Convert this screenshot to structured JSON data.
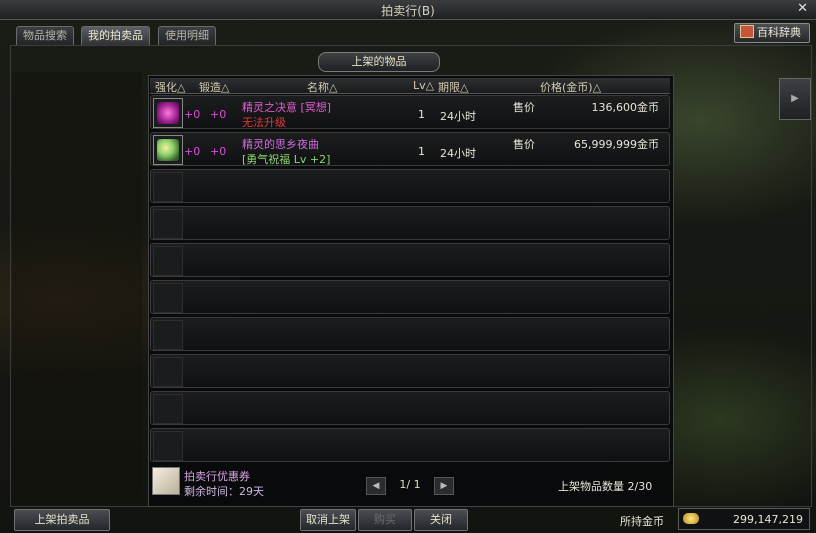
{
  "window": {
    "title": "拍卖行(B)"
  },
  "tabs": [
    {
      "label": "物品搜索",
      "active": false
    },
    {
      "label": "我的拍卖品",
      "active": true
    },
    {
      "label": "使用明细",
      "active": false
    }
  ],
  "wiki_button": {
    "label": "百科辞典",
    "icon": "book-icon"
  },
  "section": {
    "label": "上架的物品"
  },
  "headers": {
    "enhance": "强化△",
    "forge": "锻造△",
    "name": "名称△",
    "level": "Lv△",
    "period": "期限△",
    "price": "价格(金币)△"
  },
  "items": [
    {
      "enhance": "+0",
      "forge": "+0",
      "name": "精灵之决意 [冥想]",
      "sub": "无法升级",
      "level": "1",
      "period": "24小时",
      "price_label": "售价",
      "price": "136,600金币",
      "icon": "spirit-resolve-icon"
    },
    {
      "enhance": "+0",
      "forge": "+0",
      "name": "精灵的思乡夜曲",
      "sub": "[勇气祝福 Lv +2]",
      "level": "1",
      "period": "24小时",
      "price_label": "售价",
      "price": "65,999,999金币",
      "icon": "spirit-nocturne-icon"
    }
  ],
  "coupon": {
    "title": "拍卖行优惠券",
    "remaining": "剩余时间：29天",
    "icon": "coupon-icon"
  },
  "pager": {
    "text": "1/ 1"
  },
  "listing_count": {
    "label": "上架物品数量 2/30"
  },
  "buttons": {
    "list_item": "上架拍卖品",
    "cancel_listing": "取消上架",
    "buy": "购买",
    "close": "关闭"
  },
  "gold": {
    "label": "所持金币",
    "amount": "299,147,219"
  },
  "colors": {
    "accent": "#d94fd9",
    "warning": "#e03a3a",
    "bonus": "#8fd46b"
  }
}
